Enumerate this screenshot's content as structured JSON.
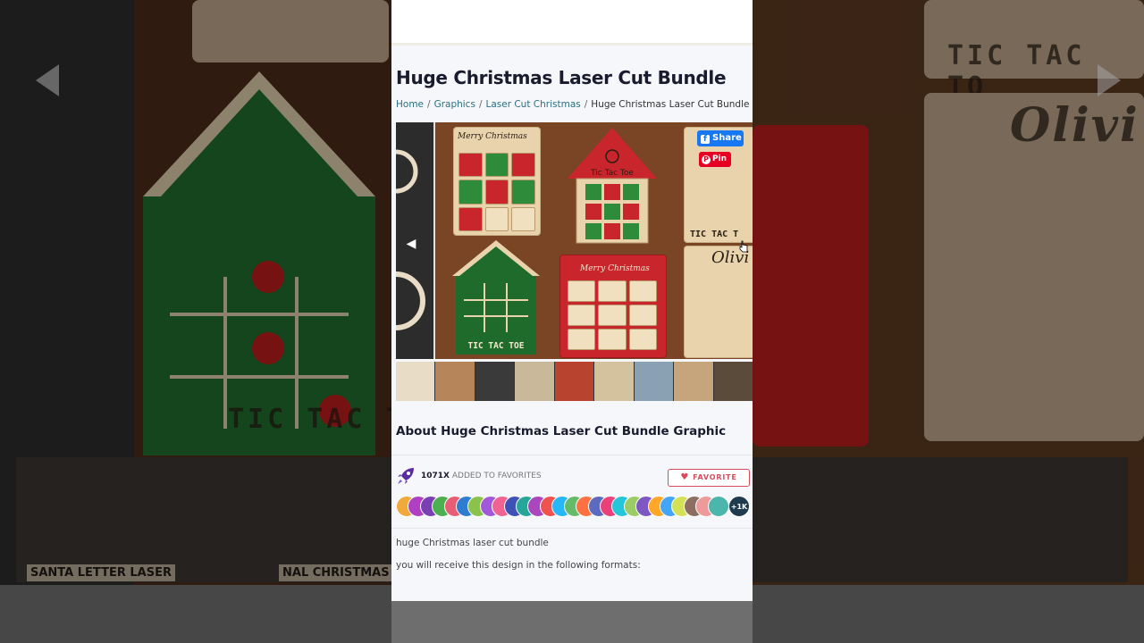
{
  "page": {
    "title": "Huge Christmas Laser Cut Bundle",
    "breadcrumb": {
      "home": "Home",
      "graphics": "Graphics",
      "category": "Laser Cut Christmas",
      "current": "Huge Christmas Laser Cut Bundle",
      "separator": "/"
    }
  },
  "gallery": {
    "share_label": "Share",
    "pin_label": "Pin",
    "card_merry": "Merry Christmas",
    "card_tictactoe_top": "Tic Tac Toe",
    "card_tictactoe_green": "TIC TAC TOE",
    "card_merry_red": "Merry Christmas",
    "card_tictac_right": "TIC TAC T",
    "card_olivia": "Olivi",
    "thumb_colors": [
      "#e9dcc6",
      "#b7855a",
      "#3a3a3a",
      "#c9b99a",
      "#b8432f",
      "#d4c29f",
      "#8aa0b3",
      "#c6a57c",
      "#5a4b3a"
    ]
  },
  "about": {
    "title": "About Huge Christmas Laser Cut Bundle Graphic"
  },
  "favorites": {
    "count": "1071X",
    "added_text": "ADDED TO FAVORITES",
    "button_label": "FAVORITE",
    "more_label": "+1K",
    "avatar_colors": [
      "#f2a93b",
      "#b03fc4",
      "#7a3fb5",
      "#4caf50",
      "#e85d75",
      "#2e7dd1",
      "#8bc34a",
      "#a259d9",
      "#f06292",
      "#3f51b5",
      "#26a69a",
      "#ab47bc",
      "#ef5350",
      "#29b6f6",
      "#66bb6a",
      "#ff7043",
      "#5c6bc0",
      "#ec407a",
      "#26c6da",
      "#9ccc65",
      "#7e57c2",
      "#ffa726",
      "#42a5f5",
      "#d4e157",
      "#8d6e63",
      "#ef9a9a",
      "#4db6ac"
    ]
  },
  "description": {
    "line1": "huge Christmas laser cut bundle",
    "line2": "you will receive this design in the following formats:"
  },
  "backdrop": {
    "text_tictac": "TIC TAC T",
    "text_tictac_right": "TIC TAC TO",
    "text_olivia": "Olivi",
    "text_santa": "SANTA LETTER LASER",
    "text_ornaments": "NAL CHRISTMAS ORNAME"
  }
}
